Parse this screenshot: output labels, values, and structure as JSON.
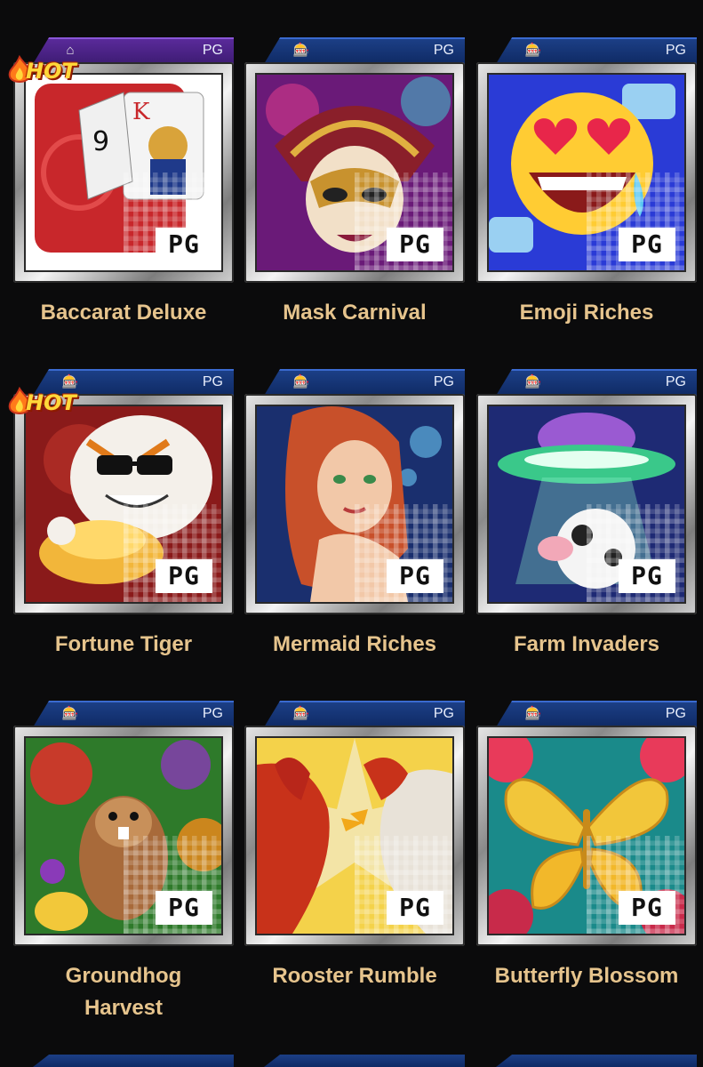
{
  "games": [
    {
      "name": "Baccarat Deluxe",
      "provider": "PG",
      "hot": true,
      "hot_label": "HOT",
      "ribbon": "purple",
      "art_colors": [
        "#c8272b",
        "#f3f3f3"
      ],
      "icon": "house-icon"
    },
    {
      "name": "Mask Carnival",
      "provider": "PG",
      "hot": false,
      "ribbon": "blue",
      "art_colors": [
        "#8a1f2a",
        "#d49a2e"
      ],
      "icon": "slot-machine-icon"
    },
    {
      "name": "Emoji Riches",
      "provider": "PG",
      "hot": false,
      "ribbon": "blue",
      "art_colors": [
        "#2a3bd6",
        "#ffcc33"
      ],
      "icon": "slot-machine-icon"
    },
    {
      "name": "Fortune Tiger",
      "provider": "PG",
      "hot": true,
      "hot_label": "HOT",
      "ribbon": "blue",
      "art_colors": [
        "#7a1a1a",
        "#f2b63a"
      ],
      "icon": "slot-machine-icon"
    },
    {
      "name": "Mermaid Riches",
      "provider": "PG",
      "hot": false,
      "ribbon": "blue",
      "art_colors": [
        "#1a2f6e",
        "#d06a42"
      ],
      "icon": "slot-machine-icon"
    },
    {
      "name": "Farm Invaders",
      "provider": "PG",
      "hot": false,
      "ribbon": "blue",
      "art_colors": [
        "#1e2a74",
        "#9a5ad2"
      ],
      "icon": "slot-machine-icon"
    },
    {
      "name": "Groundhog Harvest",
      "provider": "PG",
      "hot": false,
      "ribbon": "blue",
      "art_colors": [
        "#2e7a2a",
        "#c83a2a"
      ],
      "icon": "slot-machine-icon"
    },
    {
      "name": "Rooster Rumble",
      "provider": "PG",
      "hot": false,
      "ribbon": "blue",
      "art_colors": [
        "#c8321a",
        "#f4d24a"
      ],
      "icon": "slot-machine-icon"
    },
    {
      "name": "Butterfly Blossom",
      "provider": "PG",
      "hot": false,
      "ribbon": "blue",
      "art_colors": [
        "#1a8a8a",
        "#f2c63a"
      ],
      "icon": "slot-machine-icon"
    }
  ],
  "logo_text": "PG"
}
